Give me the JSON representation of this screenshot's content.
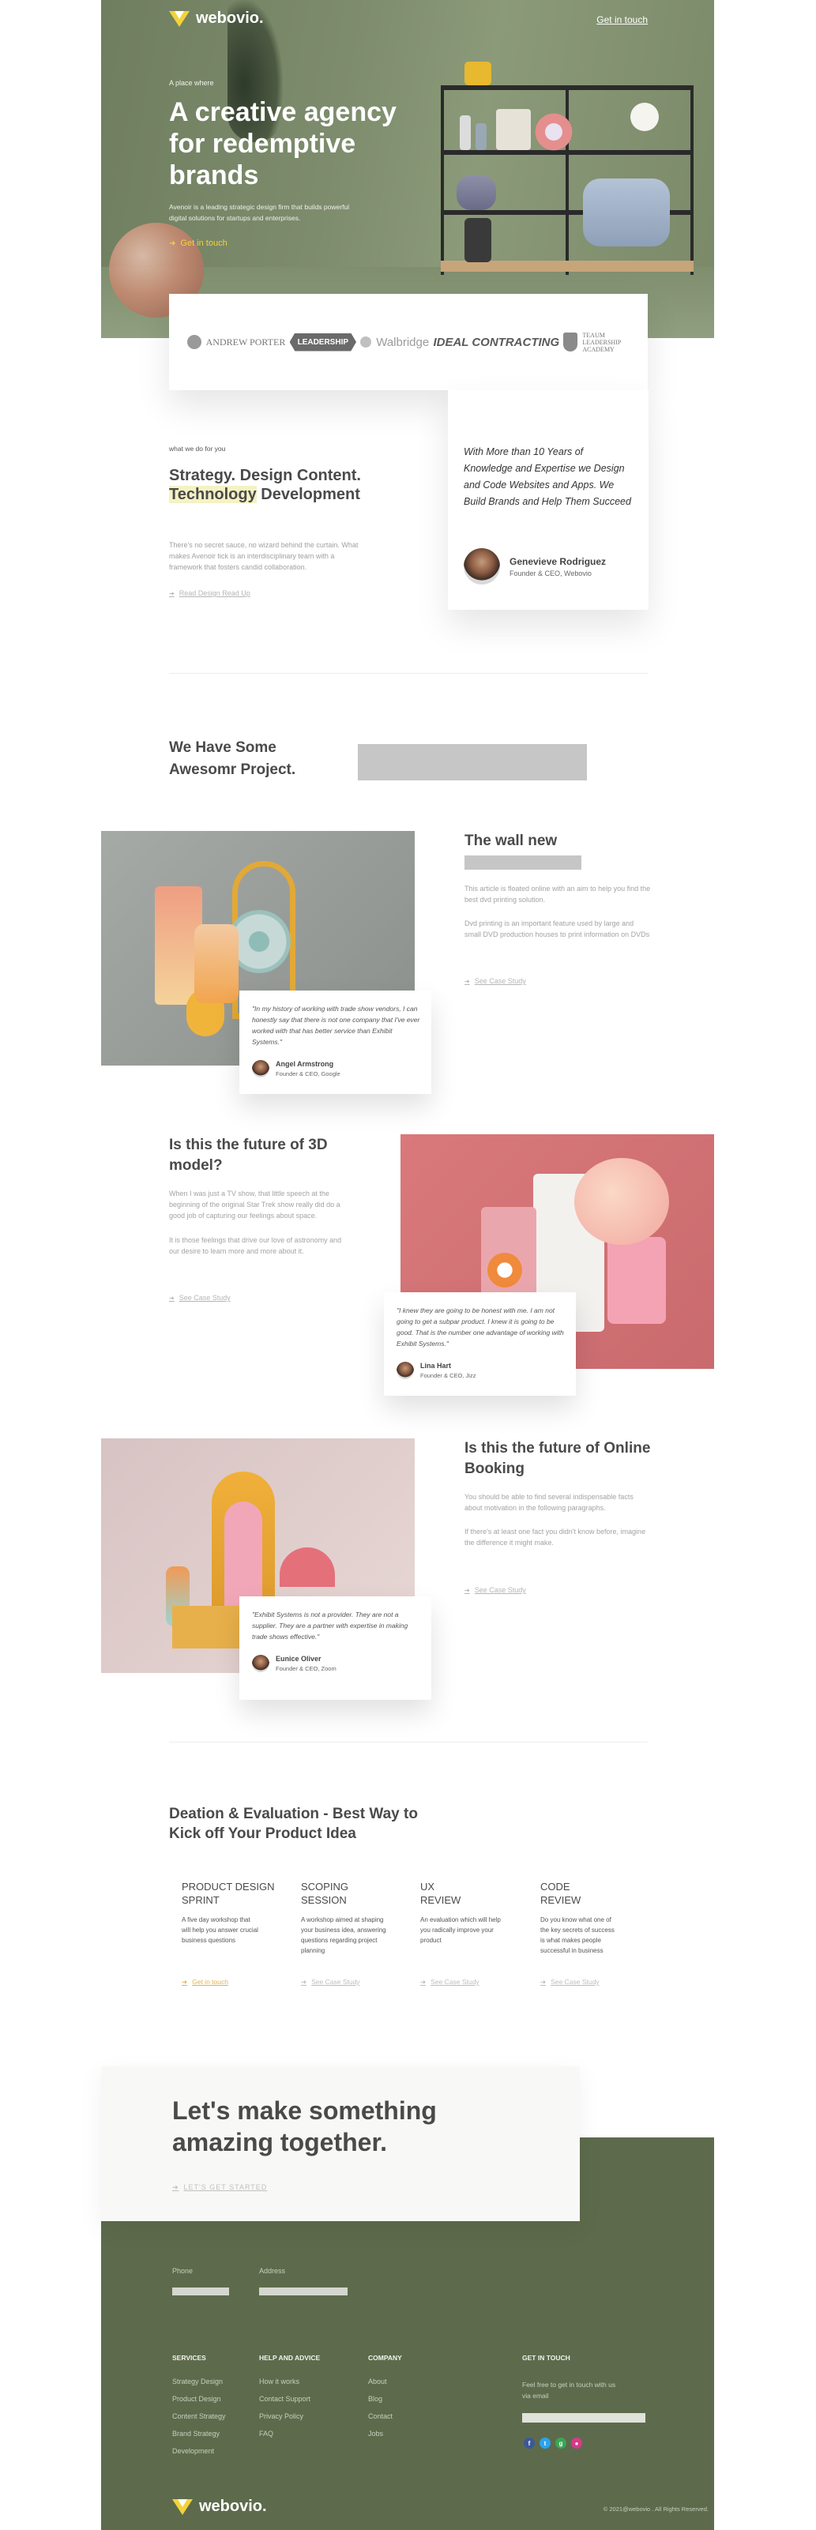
{
  "brand": {
    "name": "webovio.",
    "accent": "#f2d33a",
    "olive": "#5d6b4c"
  },
  "hero": {
    "cta_top": "Get in touch",
    "kicker": "A place where",
    "title": "A creative agency for redemptive brands",
    "description": "Avenoir is a leading strategic design firm that builds powerful digital solutions for startups and enterprises.",
    "button": "Get in touch"
  },
  "logos": {
    "items": [
      "ANDREW PORTER",
      "LEADERSHIP",
      "Walbridge",
      "IDEAL CONTRACTING",
      "TEAUM LEADERSHIP ACADEMY"
    ]
  },
  "strategy": {
    "label": "what we do for you",
    "title_a": "Strategy. Design Content. ",
    "title_hl": "Technology",
    "title_b": " Development",
    "description": "There's no secret sauce, no wizard behind the curtain. What makes Avenoir tick is an interdisciplinary team with a framework that fosters candid collaboration.",
    "link": "Read Design Read Up"
  },
  "testimonial_main": {
    "quote": "With More than 10 Years of Knowledge and Expertise we Design and Code Websites and Apps. We Build Brands and Help Them Succeed",
    "name": "Genevieve Rodriguez",
    "role": "Founder & CEO, Webovio"
  },
  "projects": {
    "title": "We Have Some Awesomr Project.",
    "items": [
      {
        "title": "The wall new",
        "p1": "This article is floated online with an aim to help you find the best dvd printing solution.",
        "p2": "Dvd printing is an important feature used by large and small DVD production houses to print information on DVDs",
        "link": "See Case Study",
        "quote": "\"In my history of working with trade show vendors, I can honestly say that there is not one company that I've ever worked with that has better service than Exhibit Systems.\"",
        "name": "Angel Armstrong",
        "role": "Founder & CEO, Google"
      },
      {
        "title": "Is this the future of 3D model?",
        "p1": "When I was just a TV show, that little speech at the beginning of the original Star Trek show really did do a good job of capturing our feelings about space.",
        "p2": "It is those feelings that drive our love of astronomy and our desire to learn more and more about it.",
        "link": "See Case Study",
        "quote": "\"I knew they are going to be honest with me. I am not going to get a subpar product. I knew it is going to be good. That is the number one advantage of working with Exhibit Systems.\"",
        "name": "Lina Hart",
        "role": "Founder & CEO, Jizz"
      },
      {
        "title": "Is this the future of Online Booking",
        "p1": "You should be able to find several indispensable facts about motivation in the following paragraphs.",
        "p2": "If there's at least one fact you didn't know before, imagine the difference it might make.",
        "link": "See Case Study",
        "quote": "\"Exhibit Systems is not a provider. They are not a supplier. They are a partner with expertise in making trade shows effective.\"",
        "name": "Eunice Oliver",
        "role": "Founder & CEO, Zoom"
      }
    ]
  },
  "sprint": {
    "title": "Deation & Evaluation - Best Way to Kick off Your Product Idea",
    "columns": [
      {
        "title": "Product Design Sprint",
        "desc": "A five day workshop that will help you answer crucial business questions",
        "link": "Get in touch"
      },
      {
        "title": "Scoping Session",
        "desc": "A workshop aimed at shaping your business idea, answering questions regarding project planning",
        "link": "See Case Study"
      },
      {
        "title": "UX Review",
        "desc": "An evaluation which will help you radically improve your product",
        "link": "See Case Study"
      },
      {
        "title": "Code Review",
        "desc": "Do you know what one of the key secrets of success is what makes people successful in business",
        "link": "See Case Study"
      }
    ]
  },
  "cta": {
    "title": "Let's make something amazing together.",
    "link": "LET'S GET STARTED"
  },
  "footer": {
    "phone_label": "Phone",
    "address_label": "Address",
    "services": {
      "title": "SERVICES",
      "items": [
        "Strategy Design",
        "Product Design",
        "Content Strategy",
        "Brand Strategy",
        "Development"
      ]
    },
    "help": {
      "title": "HELP AND ADVICE",
      "items": [
        "How it works",
        "Contact Support",
        "Privacy Policy",
        "FAQ"
      ]
    },
    "company": {
      "title": "COMPANY",
      "items": [
        "About",
        "Blog",
        "Contact",
        "Jobs"
      ]
    },
    "touch": {
      "title": "GET IN TOUCH",
      "text": "Feel free to get in touch with us via email"
    },
    "social": [
      "facebook-icon",
      "twitter-icon",
      "google-plus-icon",
      "instagram-icon"
    ],
    "copyright": "© 2021@webovio . All Rights Reserved."
  }
}
